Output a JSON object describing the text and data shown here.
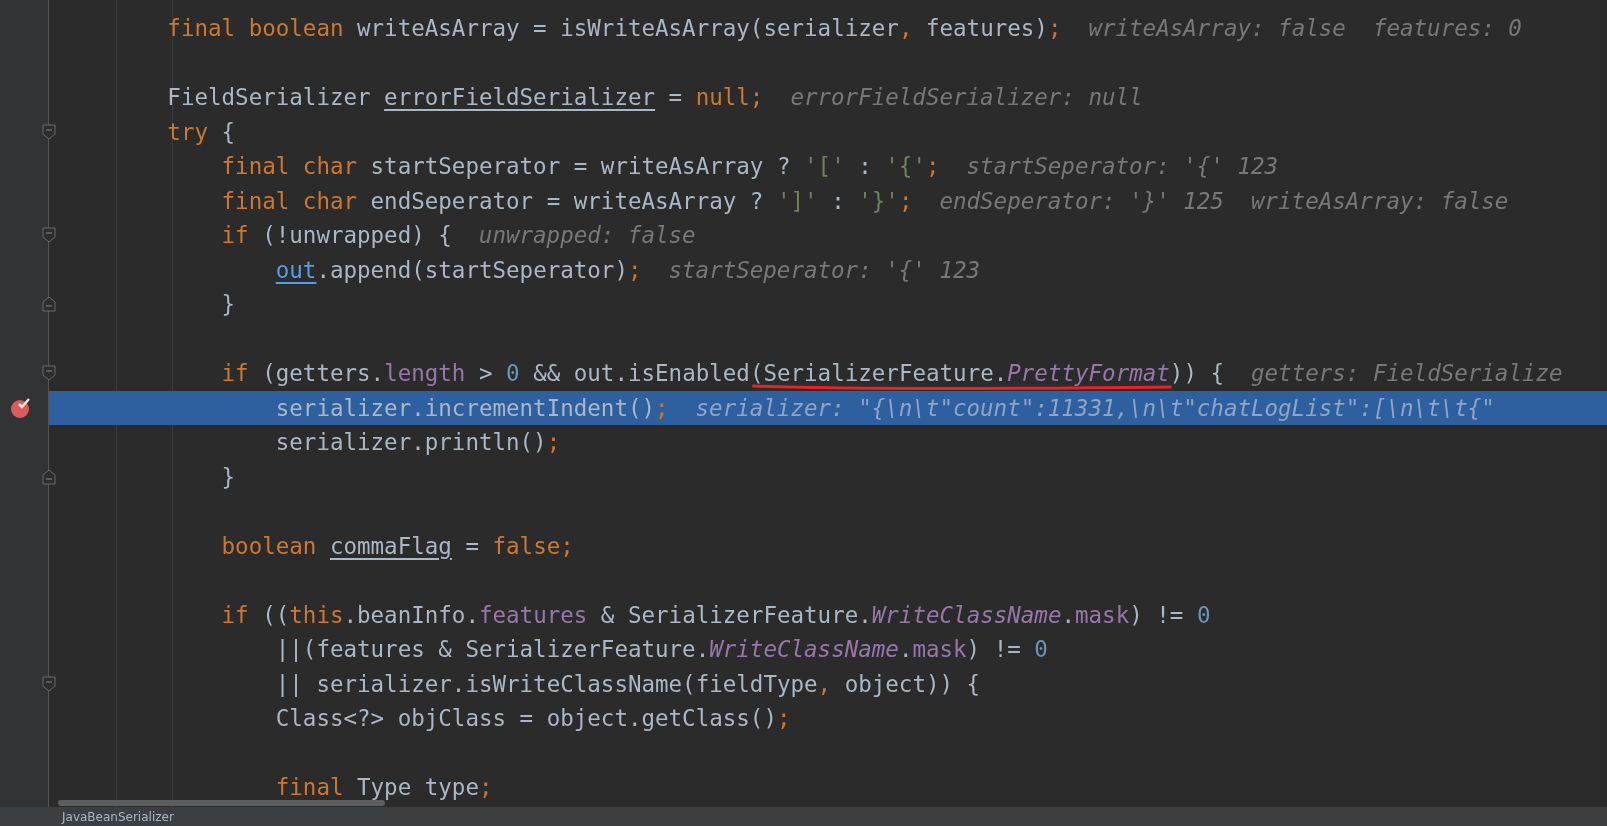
{
  "editor": {
    "lines": [
      {
        "kind": "code",
        "current": false,
        "breakpoint": false,
        "tokens": [
          {
            "kind": "kw",
            "text": "        final boolean "
          },
          {
            "kind": "plain",
            "text": "writeAsArray = isWriteAsArray(serializer"
          },
          {
            "kind": "kw",
            "text": ", "
          },
          {
            "kind": "plain",
            "text": "features)"
          },
          {
            "kind": "kw",
            "text": ";"
          }
        ],
        "hint": "writeAsArray: false  features: 0"
      },
      {
        "kind": "code",
        "current": false,
        "breakpoint": false
      },
      {
        "kind": "code",
        "current": false,
        "breakpoint": false,
        "tokens": [
          {
            "kind": "plain",
            "text": "        FieldSerializer "
          },
          {
            "kind": "decl",
            "text": "errorFieldSerializer"
          },
          {
            "kind": "plain",
            "text": " = "
          },
          {
            "kind": "kw",
            "text": "null;"
          }
        ],
        "hint": "errorFieldSerializer: null"
      },
      {
        "kind": "fold-start",
        "current": false,
        "breakpoint": false,
        "tokens": [
          {
            "kind": "kw",
            "text": "        try"
          },
          {
            "kind": "plain",
            "text": " {"
          }
        ]
      },
      {
        "kind": "code",
        "current": false,
        "breakpoint": false,
        "tokens": [
          {
            "kind": "kw",
            "text": "            final char "
          },
          {
            "kind": "plain",
            "text": "startSeperator = writeAsArray ? "
          },
          {
            "kind": "str",
            "text": "'['"
          },
          {
            "kind": "plain",
            "text": " : "
          },
          {
            "kind": "str",
            "text": "'{'"
          },
          {
            "kind": "kw",
            "text": ";"
          }
        ],
        "hint": "startSeperator: '{' 123"
      },
      {
        "kind": "code",
        "current": false,
        "breakpoint": false,
        "tokens": [
          {
            "kind": "kw",
            "text": "            final char "
          },
          {
            "kind": "plain",
            "text": "endSeperator = writeAsArray ? "
          },
          {
            "kind": "str",
            "text": "']'"
          },
          {
            "kind": "plain",
            "text": " : "
          },
          {
            "kind": "str",
            "text": "'}'"
          },
          {
            "kind": "kw",
            "text": ";"
          }
        ],
        "hint": "endSeperator: '}' 125  writeAsArray: false"
      },
      {
        "kind": "fold-start",
        "current": false,
        "breakpoint": false,
        "tokens": [
          {
            "kind": "kw",
            "text": "            if"
          },
          {
            "kind": "plain",
            "text": " (!unwrapped) {"
          }
        ],
        "hint": "unwrapped: false"
      },
      {
        "kind": "code",
        "current": false,
        "breakpoint": false,
        "tokens": [
          {
            "kind": "ref",
            "text": "                out"
          },
          {
            "kind": "plain",
            "text": ".append(startSeperator)"
          },
          {
            "kind": "kw",
            "text": ";"
          }
        ],
        "hint": "startSeperator: '{' 123"
      },
      {
        "kind": "fold-end",
        "current": false,
        "breakpoint": false,
        "tokens": [
          {
            "kind": "plain",
            "text": "            }"
          }
        ]
      },
      {
        "kind": "code",
        "current": false,
        "breakpoint": false
      },
      {
        "kind": "fold-start",
        "current": false,
        "breakpoint": false,
        "tokens": [
          {
            "kind": "kw",
            "text": "            if"
          },
          {
            "kind": "plain",
            "text": " (getters."
          },
          {
            "kind": "field",
            "text": "length"
          },
          {
            "kind": "plain",
            "text": " > "
          },
          {
            "kind": "num",
            "text": "0"
          },
          {
            "kind": "plain",
            "text": " && out.isEnabled"
          },
          {
            "kind": "underlined-group",
            "children": [
              {
                "kind": "plain",
                "text": "(SerializerFeature."
              },
              {
                "kind": "const",
                "text": "PrettyFormat"
              }
            ]
          },
          {
            "kind": "plain",
            "text": ")) {"
          }
        ],
        "hint": "getters: FieldSerialize"
      },
      {
        "kind": "code",
        "current": true,
        "breakpoint": true,
        "tokens": [
          {
            "kind": "plain",
            "text": "                serializer.incrementIndent()"
          },
          {
            "kind": "kw",
            "text": ";"
          }
        ],
        "hint": "serializer: \"{\\n\\t\"count\":11331,\\n\\t\"chatLogList\":[\\n\\t\\t{\""
      },
      {
        "kind": "code",
        "current": false,
        "breakpoint": false,
        "tokens": [
          {
            "kind": "plain",
            "text": "                serializer.println()"
          },
          {
            "kind": "kw",
            "text": ";"
          }
        ]
      },
      {
        "kind": "fold-end",
        "current": false,
        "breakpoint": false,
        "tokens": [
          {
            "kind": "plain",
            "text": "            }"
          }
        ]
      },
      {
        "kind": "code",
        "current": false,
        "breakpoint": false
      },
      {
        "kind": "code",
        "current": false,
        "breakpoint": false,
        "tokens": [
          {
            "kind": "kw",
            "text": "            boolean "
          },
          {
            "kind": "decl",
            "text": "commaFlag"
          },
          {
            "kind": "plain",
            "text": " = "
          },
          {
            "kind": "kw",
            "text": "false;"
          }
        ]
      },
      {
        "kind": "code",
        "current": false,
        "breakpoint": false
      },
      {
        "kind": "code",
        "current": false,
        "breakpoint": false,
        "tokens": [
          {
            "kind": "kw",
            "text": "            if"
          },
          {
            "kind": "plain",
            "text": " (("
          },
          {
            "kind": "kw",
            "text": "this"
          },
          {
            "kind": "plain",
            "text": ".beanInfo."
          },
          {
            "kind": "field",
            "text": "features"
          },
          {
            "kind": "plain",
            "text": " & SerializerFeature."
          },
          {
            "kind": "const",
            "text": "WriteClassName"
          },
          {
            "kind": "plain",
            "text": "."
          },
          {
            "kind": "field",
            "text": "mask"
          },
          {
            "kind": "plain",
            "text": ") != "
          },
          {
            "kind": "num",
            "text": "0"
          }
        ]
      },
      {
        "kind": "code",
        "current": false,
        "breakpoint": false,
        "tokens": [
          {
            "kind": "plain",
            "text": "                ||(features & SerializerFeature."
          },
          {
            "kind": "const",
            "text": "WriteClassName"
          },
          {
            "kind": "plain",
            "text": "."
          },
          {
            "kind": "field",
            "text": "mask"
          },
          {
            "kind": "plain",
            "text": ") != "
          },
          {
            "kind": "num",
            "text": "0"
          }
        ]
      },
      {
        "kind": "fold-start",
        "current": false,
        "breakpoint": false,
        "tokens": [
          {
            "kind": "plain",
            "text": "                || serializer.isWriteClassName(fieldType"
          },
          {
            "kind": "kw",
            "text": ", "
          },
          {
            "kind": "plain",
            "text": "object)) {"
          }
        ]
      },
      {
        "kind": "code",
        "current": false,
        "breakpoint": false,
        "tokens": [
          {
            "kind": "plain",
            "text": "                Class<?> objClass = object.getClass()"
          },
          {
            "kind": "kw",
            "text": ";"
          }
        ]
      },
      {
        "kind": "code",
        "current": false,
        "breakpoint": false
      },
      {
        "kind": "code",
        "current": false,
        "breakpoint": false,
        "tokens": [
          {
            "kind": "kw",
            "text": "                final "
          },
          {
            "kind": "plain",
            "text": "Type type"
          },
          {
            "kind": "kw",
            "text": ";"
          }
        ]
      }
    ]
  },
  "editor_tab": {
    "label": "JavaBeanSerializer"
  }
}
